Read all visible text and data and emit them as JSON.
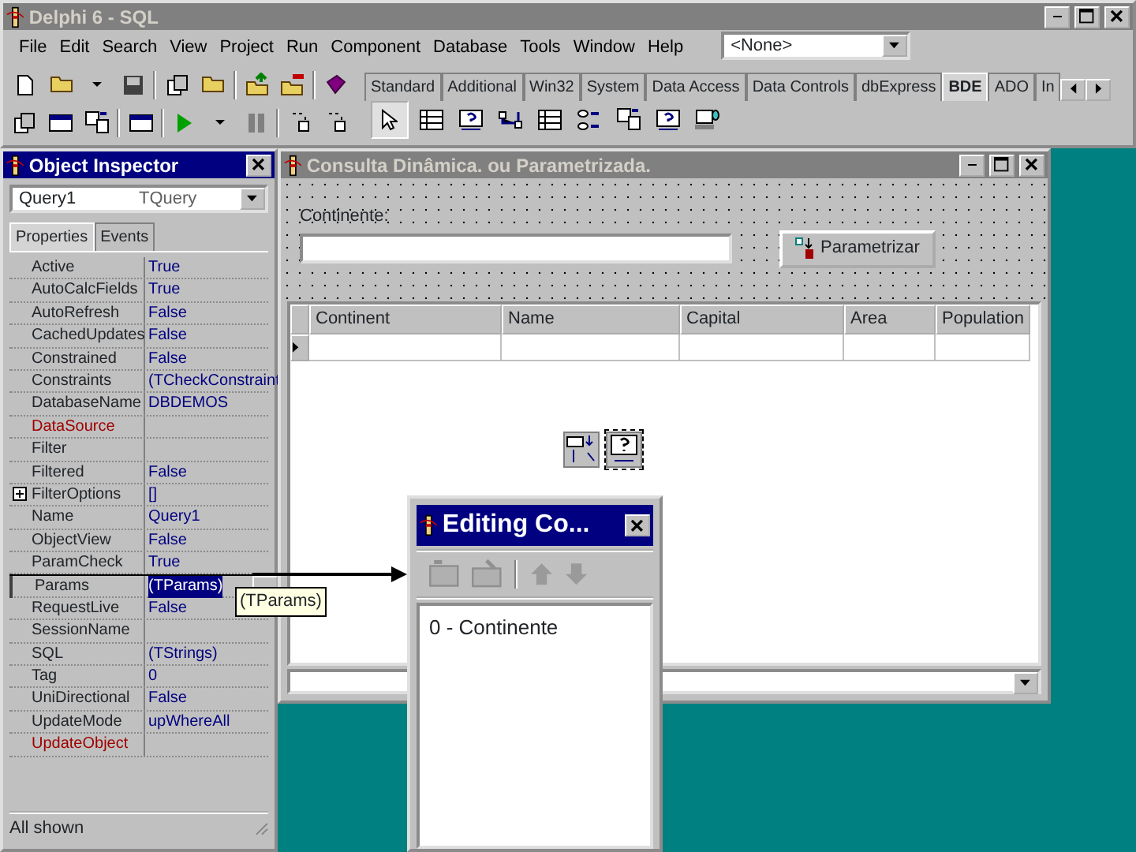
{
  "main_window": {
    "title": "Delphi 6 - SQL",
    "menu": [
      {
        "label": "File"
      },
      {
        "label": "Edit"
      },
      {
        "label": "Search"
      },
      {
        "label": "View"
      },
      {
        "label": "Project"
      },
      {
        "label": "Run"
      },
      {
        "label": "Component"
      },
      {
        "label": "Database"
      },
      {
        "label": "Tools"
      },
      {
        "label": "Window"
      },
      {
        "label": "Help"
      }
    ],
    "desktop_combo": {
      "value": "<None>"
    },
    "palette_tabs": [
      {
        "label": "Standard",
        "selected": false
      },
      {
        "label": "Additional",
        "selected": false
      },
      {
        "label": "Win32",
        "selected": false
      },
      {
        "label": "System",
        "selected": false
      },
      {
        "label": "Data Access",
        "selected": false
      },
      {
        "label": "Data Controls",
        "selected": false
      },
      {
        "label": "dbExpress",
        "selected": false
      },
      {
        "label": "BDE",
        "selected": true
      },
      {
        "label": "ADO",
        "selected": false
      },
      {
        "label": "In",
        "selected": false
      }
    ]
  },
  "object_inspector": {
    "title": "Object Inspector",
    "object_name": "Query1",
    "object_type": "TQuery",
    "tabs": [
      {
        "label": "Properties",
        "selected": true
      },
      {
        "label": "Events",
        "selected": false
      }
    ],
    "properties": [
      {
        "name": "Active",
        "value": "True",
        "kind": "plain",
        "expandable": false,
        "selected": false
      },
      {
        "name": "AutoCalcFields",
        "value": "True",
        "kind": "plain",
        "expandable": false,
        "selected": false
      },
      {
        "name": "AutoRefresh",
        "value": "False",
        "kind": "plain",
        "expandable": false,
        "selected": false
      },
      {
        "name": "CachedUpdates",
        "value": "False",
        "kind": "plain",
        "expandable": false,
        "selected": false
      },
      {
        "name": "Constrained",
        "value": "False",
        "kind": "plain",
        "expandable": false,
        "selected": false
      },
      {
        "name": "Constraints",
        "value": "(TCheckConstraint",
        "kind": "plain",
        "expandable": false,
        "selected": false
      },
      {
        "name": "DatabaseName",
        "value": "DBDEMOS",
        "kind": "plain",
        "expandable": false,
        "selected": false
      },
      {
        "name": "DataSource",
        "kind": "reference",
        "expandable": false,
        "selected": false
      },
      {
        "name": "Filter",
        "kind": "plain",
        "expandable": false,
        "selected": false
      },
      {
        "name": "Filtered",
        "value": "False",
        "kind": "plain",
        "expandable": false,
        "selected": false
      },
      {
        "name": "FilterOptions",
        "value": "[]",
        "kind": "plain",
        "expandable": true,
        "selected": false
      },
      {
        "name": "Name",
        "value": "Query1",
        "kind": "plain",
        "expandable": false,
        "selected": false
      },
      {
        "name": "ObjectView",
        "value": "False",
        "kind": "plain",
        "expandable": false,
        "selected": false
      },
      {
        "name": "ParamCheck",
        "value": "True",
        "kind": "plain",
        "expandable": false,
        "selected": false
      },
      {
        "name": "Params",
        "value": "(TParams)",
        "kind": "plain",
        "expandable": false,
        "selected": true
      },
      {
        "name": "RequestLive",
        "value": "False",
        "kind": "plain",
        "expandable": false,
        "selected": false
      },
      {
        "name": "SessionName",
        "kind": "plain",
        "expandable": false,
        "selected": false
      },
      {
        "name": "SQL",
        "value": "(TStrings)",
        "kind": "plain",
        "expandable": false,
        "selected": false
      },
      {
        "name": "Tag",
        "value": "0",
        "kind": "plain",
        "expandable": false,
        "selected": false
      },
      {
        "name": "UniDirectional",
        "value": "False",
        "kind": "plain",
        "expandable": false,
        "selected": false
      },
      {
        "name": "UpdateMode",
        "value": "upWhereAll",
        "kind": "plain",
        "expandable": false,
        "selected": false
      },
      {
        "name": "UpdateObject",
        "kind": "reference",
        "expandable": false,
        "selected": false
      }
    ],
    "tooltip": "(TParams)",
    "status": "All shown"
  },
  "form_window": {
    "title": "Consulta Dinâmica. ou Parametrizada.",
    "label": "Continente:",
    "button": "Parametrizar",
    "grid": {
      "columns": [
        "Continent",
        "Name",
        "Capital",
        "Area",
        "Population"
      ]
    }
  },
  "editing_dialog": {
    "title": "Editing Co...",
    "items": [
      "0 - Continente"
    ]
  }
}
